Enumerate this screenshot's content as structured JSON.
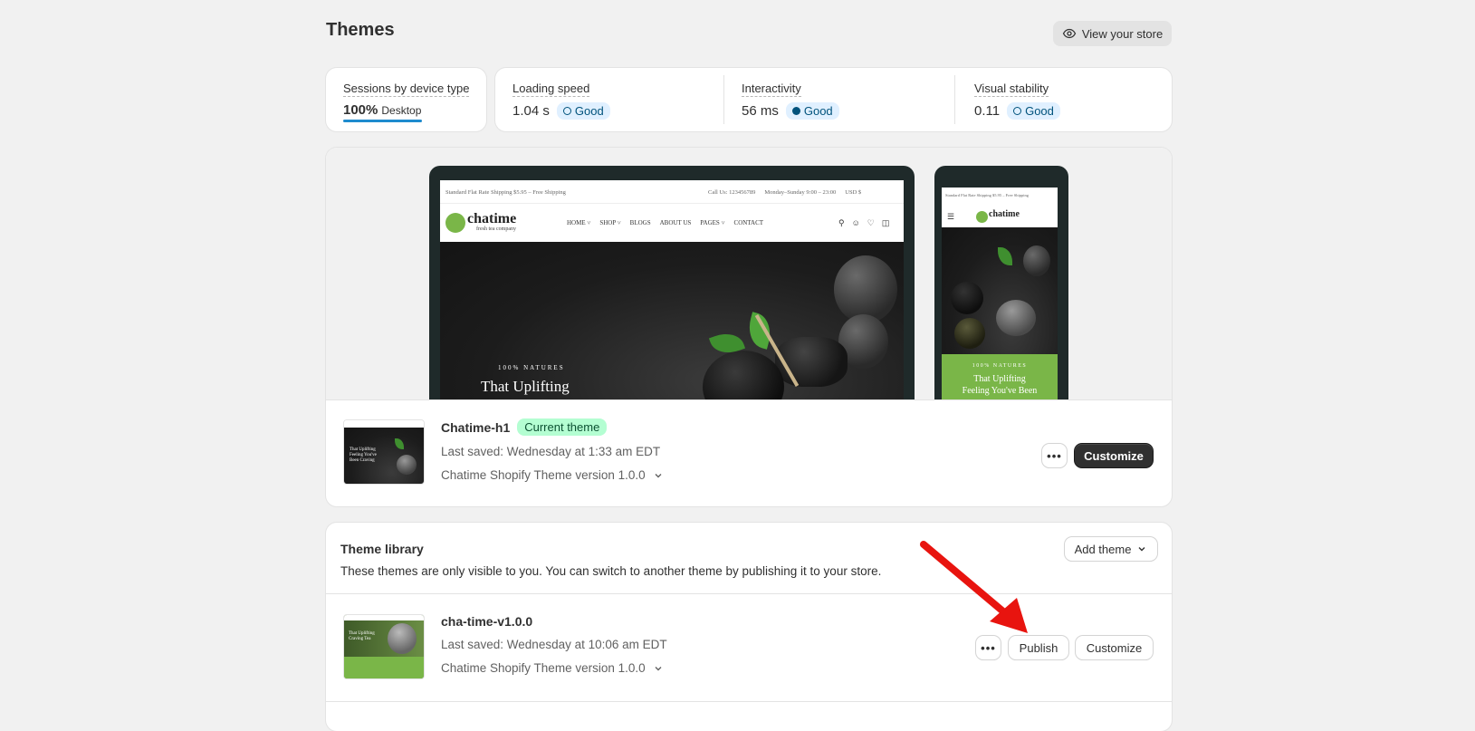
{
  "header": {
    "title": "Themes",
    "view_store_label": "View your store"
  },
  "sessions": {
    "label": "Sessions by device type",
    "percent": "100%",
    "device": "Desktop",
    "bar_fill": 1.0,
    "bar_color": "#1e8bce"
  },
  "metrics": [
    {
      "label": "Loading speed",
      "value": "1.04 s",
      "badge": "Good"
    },
    {
      "label": "Interactivity",
      "value": "56 ms",
      "badge": "Good"
    },
    {
      "label": "Visual stability",
      "value": "0.11",
      "badge": "Good"
    }
  ],
  "preview": {
    "desktop": {
      "topbar_left": "Standard Flat Rate Shipping $5.95 – Free Shipping",
      "call": "Call Us: 123456789",
      "hours": "Monday–Sunday 9:00 – 23:00",
      "currency": "USD $",
      "logo": "chatime",
      "logo_sub": "fresh tea company",
      "nav": [
        "HOME",
        "SHOP",
        "BLOGS",
        "ABOUT US",
        "PAGES",
        "CONTACT"
      ],
      "hero_kicker": "100% NATURES",
      "hero_title": "That Uplifting"
    },
    "mobile": {
      "topbar": "Standard Flat Rate Shipping $5.95 – Free Shipping",
      "logo": "chatime",
      "hero_kicker": "100% NATURES",
      "hero_title_1": "That Uplifting",
      "hero_title_2": "Feeling You've Been"
    },
    "brand_green": "#7ab648"
  },
  "current_theme": {
    "name": "Chatime-h1",
    "badge": "Current theme",
    "last_saved": "Last saved: Wednesday at 1:33 am EDT",
    "version": "Chatime Shopify Theme version 1.0.0",
    "thumb_text": "That Uplifting Feeling You've Been Craving",
    "more_label": "•••",
    "customize_label": "Customize"
  },
  "library": {
    "title": "Theme library",
    "subtitle": "These themes are only visible to you. You can switch to another theme by publishing it to your store.",
    "add_theme_label": "Add theme",
    "themes": [
      {
        "name": "cha-time-v1.0.0",
        "last_saved": "Last saved: Wednesday at 10:06 am EDT",
        "version": "Chatime Shopify Theme version 1.0.0",
        "thumb_text": "That Uplifting Craving Tea",
        "more_label": "•••",
        "publish_label": "Publish",
        "customize_label": "Customize"
      }
    ]
  },
  "annotation": {
    "arrow_color": "#e8140f"
  }
}
